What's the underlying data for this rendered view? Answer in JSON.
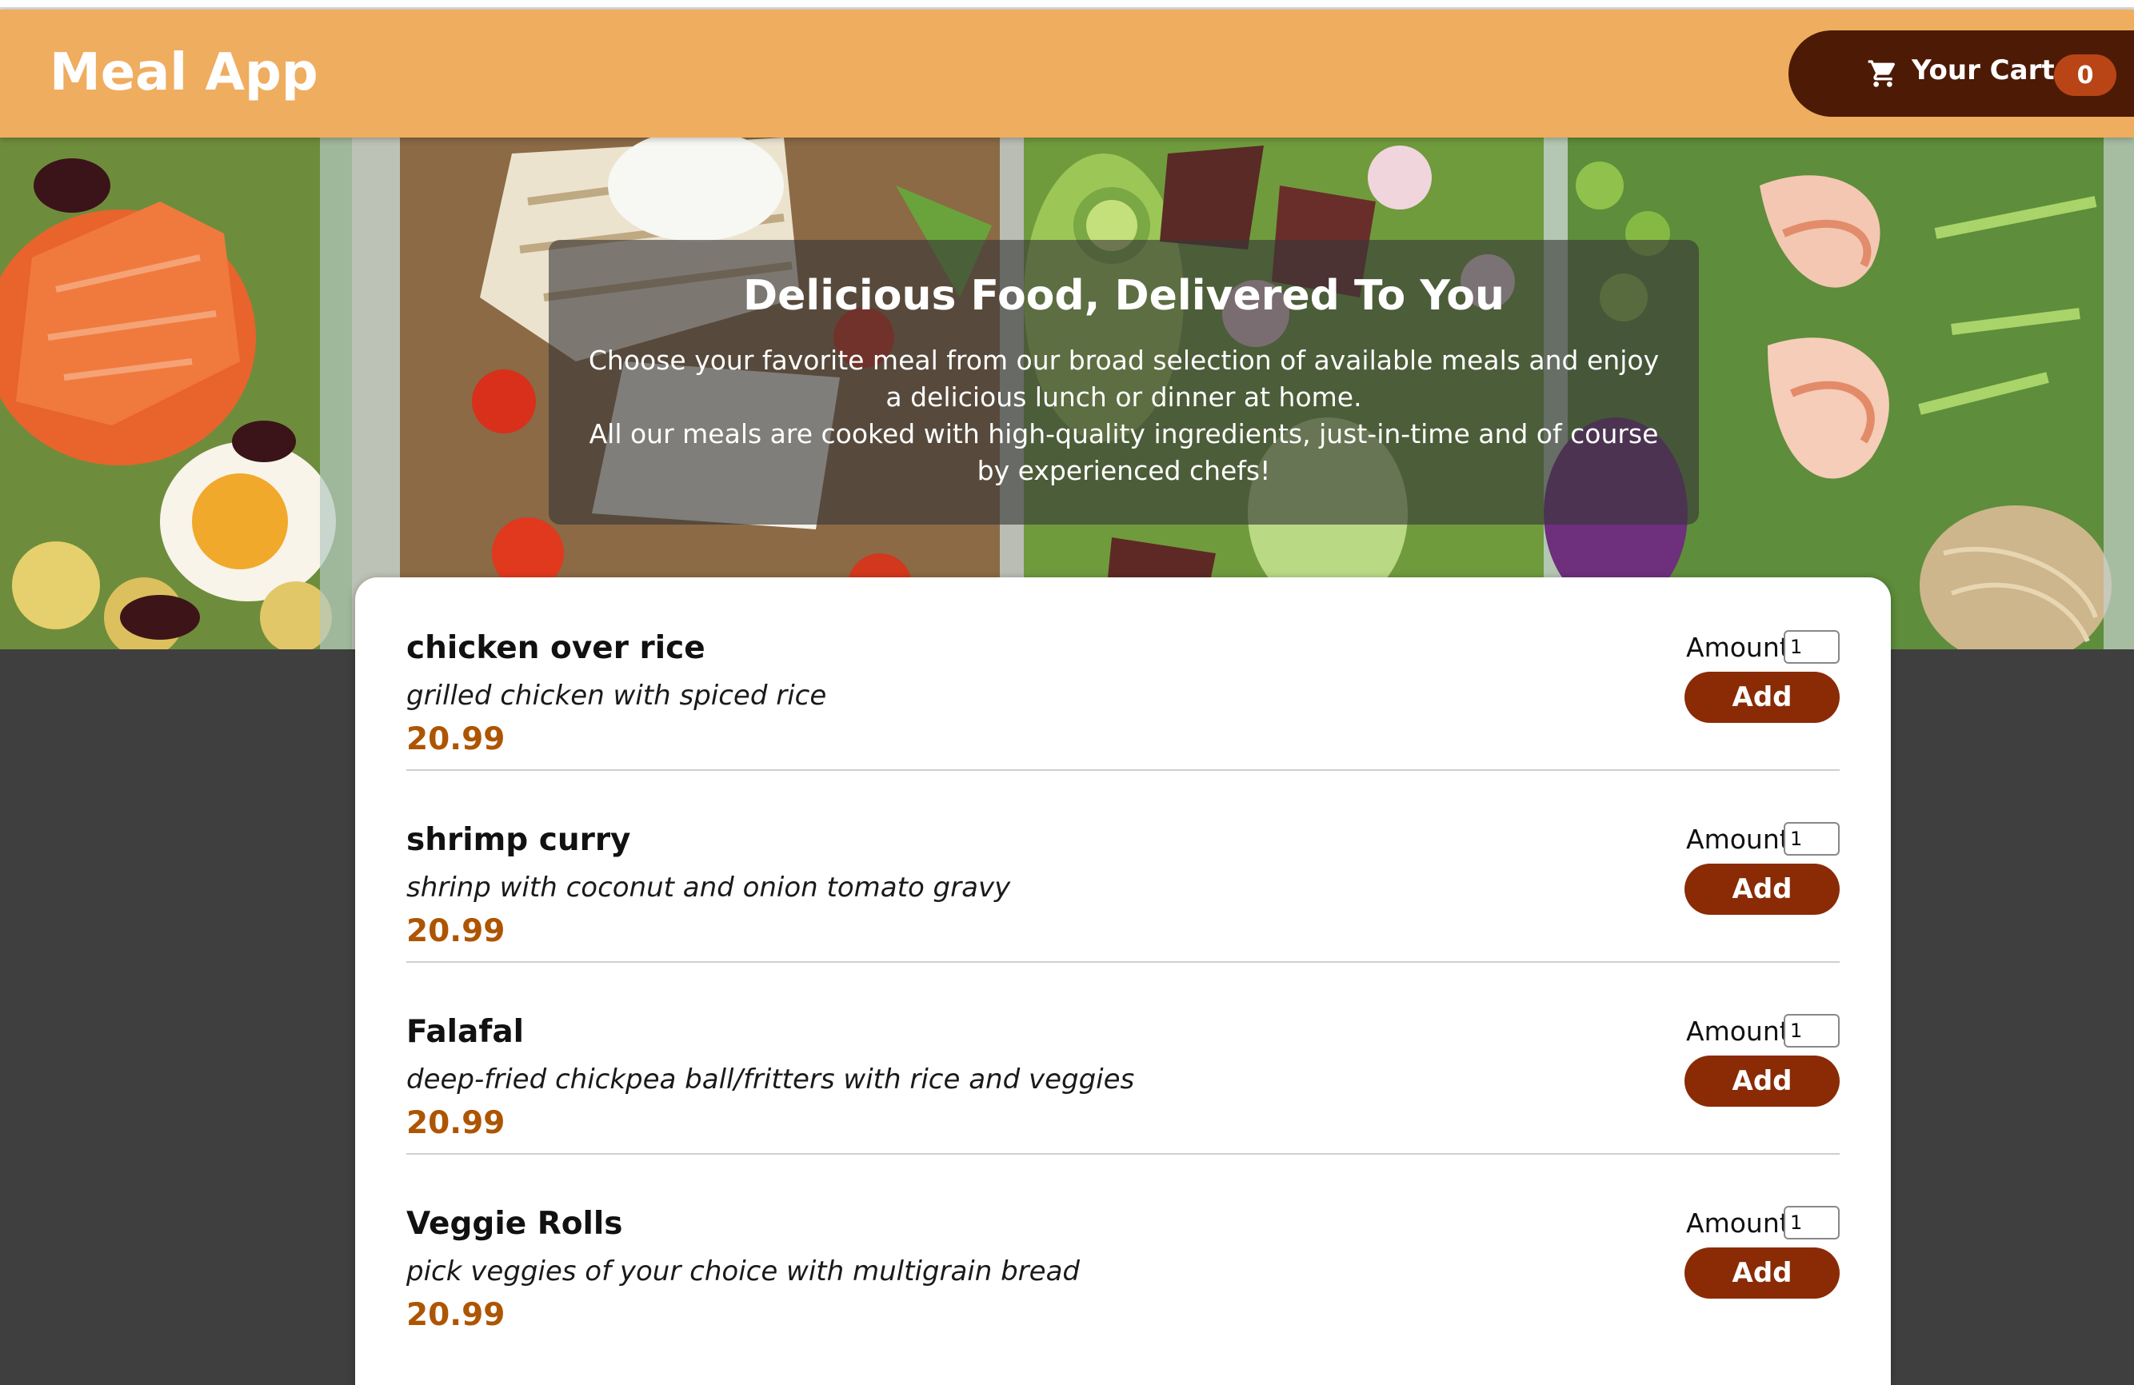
{
  "header": {
    "app_title": "Meal App",
    "cart": {
      "label": "Your Cart",
      "count": "0",
      "icon": "cart-icon"
    }
  },
  "hero": {
    "title": "Delicious Food, Delivered To You",
    "paragraph_1": "Choose your favorite meal from our broad selection of available meals and enjoy a delicious lunch or dinner at home.",
    "paragraph_2": "All our meals are cooked with high-quality ingredients, just-in-time and of course by experienced chefs!"
  },
  "meals": [
    {
      "name": "chicken over rice",
      "description": "grilled chicken with spiced rice",
      "price": "20.99",
      "amount_label": "Amount",
      "amount_value": "1",
      "add_label": "Add"
    },
    {
      "name": "shrimp curry",
      "description": "shrinp with coconut and onion tomato gravy",
      "price": "20.99",
      "amount_label": "Amount",
      "amount_value": "1",
      "add_label": "Add"
    },
    {
      "name": "Falafal",
      "description": "deep-fried chickpea ball/fritters with rice and veggies",
      "price": "20.99",
      "amount_label": "Amount",
      "amount_value": "1",
      "add_label": "Add"
    },
    {
      "name": "Veggie Rolls",
      "description": "pick veggies of your choice with multigrain bread",
      "price": "20.99",
      "amount_label": "Amount",
      "amount_value": "1",
      "add_label": "Add"
    }
  ],
  "colors": {
    "header_bg": "#efad60",
    "cart_bg": "#4d1a05",
    "badge_bg": "#b94516",
    "price": "#ad5502",
    "add_button": "#8a2b06",
    "page_bg": "#3f3f3f"
  }
}
